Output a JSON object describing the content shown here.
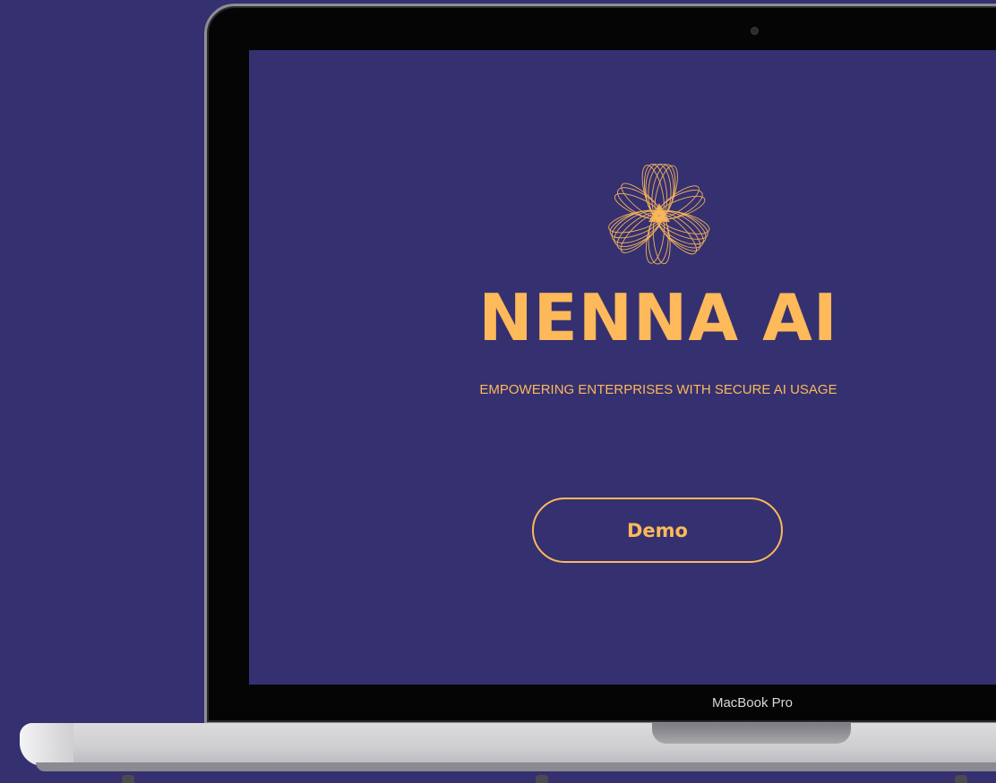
{
  "screen": {
    "brand_title": "NENNA AI",
    "tagline": "EMPOWERING ENTERPRISES WITH SECURE AI USAGE",
    "demo_label": "Demo",
    "logo_icon": "flower-petals-logo-icon"
  },
  "device": {
    "label": "MacBook Pro"
  },
  "colors": {
    "background": "#353070",
    "accent": "#FDB95A",
    "bezel": "#050505"
  }
}
